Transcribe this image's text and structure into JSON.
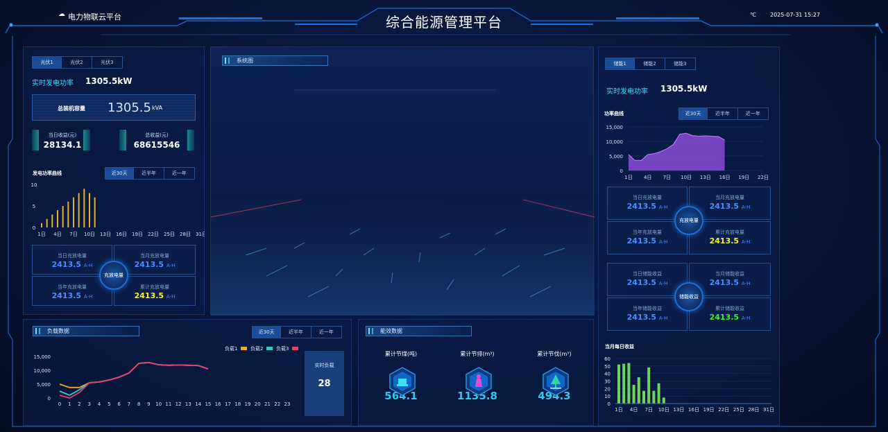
{
  "header": {
    "platform": "电力物联云平台",
    "title": "综合能源管理平台",
    "temp_unit": "℃",
    "datetime": "2025-07-31 15:27"
  },
  "left": {
    "tabs": [
      "光伏1",
      "光伏2",
      "光伏3"
    ],
    "power_label": "实时发电功率",
    "power_value": "1305.5kW",
    "capacity_label": "总装机容量",
    "capacity_value": "1305.5",
    "capacity_unit": "kVA",
    "daily_income_label": "当日收益(元)",
    "daily_income": "28134.1",
    "total_income_label": "总收益(元)",
    "total_income": "68615546",
    "chart_title": "发电功率曲线",
    "range_tabs": [
      "近30天",
      "近半年",
      "近一年"
    ],
    "quads": [
      {
        "cap": "当日充放电量",
        "val": "2413.5",
        "unit": "A-H"
      },
      {
        "cap": "当月充放电量",
        "val": "2413.5",
        "unit": "A-H"
      },
      {
        "cap": "当年充放电量",
        "val": "2413.5",
        "unit": "A-H"
      },
      {
        "cap": "累计充放电量",
        "val": "2413.5",
        "unit": "A-H"
      }
    ],
    "center": "充放电量"
  },
  "center": {
    "title": "系统图"
  },
  "right": {
    "tabs": [
      "储能1",
      "储能2",
      "储能3"
    ],
    "power_label": "实时发电功率",
    "power_value": "1305.5kW",
    "chart_title": "功率曲线",
    "range_tabs": [
      "近30天",
      "近半年",
      "近一年"
    ],
    "quads1": [
      {
        "cap": "当日充放电量",
        "val": "2413.5",
        "unit": "A-H"
      },
      {
        "cap": "当月充放电量",
        "val": "2413.5",
        "unit": "A-H"
      },
      {
        "cap": "当年充放电量",
        "val": "2413.5",
        "unit": "A-H"
      },
      {
        "cap": "累计充放电量",
        "val": "2413.5",
        "unit": "A-H"
      }
    ],
    "center1": "充放电量",
    "quads2": [
      {
        "cap": "当日储能收益",
        "val": "2413.5",
        "unit": "A-H"
      },
      {
        "cap": "当月储能收益",
        "val": "2413.5",
        "unit": "A-H"
      },
      {
        "cap": "当年储能收益",
        "val": "2413.5",
        "unit": "A-H"
      },
      {
        "cap": "累计储能收益",
        "val": "2413.5",
        "unit": "A-H"
      }
    ],
    "center2": "储能收益",
    "bar_title": "当月每日收益"
  },
  "load": {
    "title": "负载数据",
    "range_tabs": [
      "近30天",
      "近半年",
      "近一年"
    ],
    "realtime_label": "实时负载",
    "realtime_value": "28"
  },
  "eff": {
    "title": "能效数据",
    "items": [
      {
        "label": "累计节煤(吨)",
        "value": "564.1"
      },
      {
        "label": "累计节排(m³)",
        "value": "1135.8"
      },
      {
        "label": "累计节伐(m³)",
        "value": "494.3"
      }
    ]
  },
  "chart_data": [
    {
      "type": "bar",
      "title": "发电功率曲线",
      "categories": [
        "1日",
        "2日",
        "3日",
        "4日",
        "5日",
        "6日",
        "7日",
        "8日",
        "9日",
        "10日",
        "11日"
      ],
      "values": [
        1,
        2,
        3,
        4,
        5,
        6,
        7,
        8,
        9,
        8,
        7
      ],
      "x_ticks": [
        "1日",
        "4日",
        "7日",
        "10日",
        "13日",
        "16日",
        "19日",
        "22日",
        "25日",
        "28日",
        "31日"
      ],
      "ylim": [
        0,
        10
      ],
      "y_ticks": [
        0,
        5,
        10
      ]
    },
    {
      "type": "area",
      "title": "功率曲线",
      "x": [
        1,
        2,
        3,
        4,
        5,
        6,
        7,
        8,
        9,
        10,
        11,
        12,
        13,
        14,
        15,
        16
      ],
      "values": [
        5500,
        3500,
        3500,
        5500,
        5800,
        6500,
        7500,
        9000,
        12500,
        12800,
        12000,
        11800,
        11900,
        11800,
        11700,
        10500
      ],
      "x_ticks": [
        "1日",
        "4日",
        "7日",
        "10日",
        "13日",
        "16日",
        "19日",
        "22日"
      ],
      "ylim": [
        0,
        15000
      ],
      "y_ticks": [
        "15,000",
        "10,000",
        "5,000",
        "0"
      ],
      "color": "#8a4bd6"
    },
    {
      "type": "line",
      "x_ticks": [
        "0",
        "1",
        "2",
        "3",
        "4",
        "5",
        "6",
        "7",
        "8",
        "9",
        "10",
        "11",
        "12",
        "13",
        "14",
        "15",
        "16",
        "17",
        "18",
        "19",
        "20",
        "21",
        "22",
        "23"
      ],
      "ylim": [
        0,
        15000
      ],
      "y_ticks": [
        "15,000",
        "10,000",
        "5,000",
        "0"
      ],
      "series": [
        {
          "name": "负载1",
          "color": "#f5a623",
          "values": [
            5000,
            3800,
            3800,
            5500,
            5800,
            6500,
            7500,
            9000,
            12500,
            12800,
            12000,
            11800,
            11900,
            11800,
            11700,
            10500
          ]
        },
        {
          "name": "负载2",
          "color": "#3ec6c6",
          "values": [
            2500,
            1000,
            3000,
            5500,
            5800,
            6500,
            7500,
            9000,
            12500,
            12800,
            12000,
            11800,
            11900,
            11800,
            11700,
            10500
          ]
        },
        {
          "name": "负载3",
          "color": "#e83e6c",
          "values": [
            1000,
            0,
            2000,
            5500,
            5800,
            6500,
            7500,
            9000,
            12500,
            12800,
            12000,
            11800,
            11900,
            11800,
            11700,
            10500
          ]
        }
      ]
    },
    {
      "type": "bar",
      "title": "当月每日收益",
      "categories": [
        "1日",
        "2日",
        "3日",
        "4日",
        "5日",
        "6日",
        "7日",
        "8日",
        "9日",
        "10日",
        "11日"
      ],
      "values": [
        52,
        53,
        54,
        25,
        35,
        17,
        48,
        17,
        27,
        8,
        0
      ],
      "x_ticks": [
        "1日",
        "4日",
        "7日",
        "10日",
        "13日",
        "16日",
        "19日",
        "22日",
        "25日",
        "28日",
        "31日"
      ],
      "ylim": [
        0,
        60
      ],
      "y_ticks": [
        60,
        50,
        40,
        30,
        20,
        10,
        0
      ],
      "color": "#6ed45a"
    }
  ]
}
